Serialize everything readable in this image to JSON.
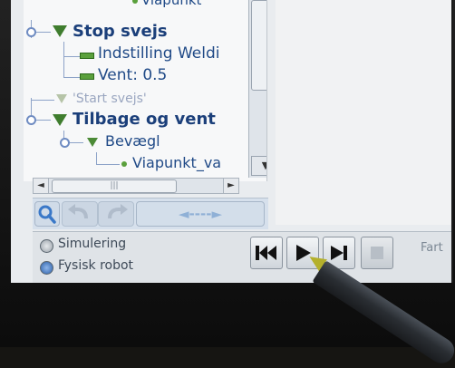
{
  "tree": {
    "top_partial": "Viapunkt",
    "items": [
      {
        "label": "Stop svejs"
      },
      {
        "label": "Indstilling Weldi"
      },
      {
        "label": "Vent: 0.5"
      },
      {
        "label": "'Start svejs'"
      },
      {
        "label": "Tilbage og vent"
      },
      {
        "label": "Bevægl"
      },
      {
        "label": "Viapunkt_va"
      }
    ]
  },
  "scrollbars": {
    "down_arrow": "▼",
    "left_arrow": "◄",
    "right_arrow": "►",
    "h_grip": "|||"
  },
  "toolbar": {
    "move_arrow": "◄----►"
  },
  "mode": {
    "simulation_label": "Simulering",
    "real_robot_label": "Fysisk robot",
    "selected": "Fysisk robot"
  },
  "playback": {
    "speed_label": "Fart"
  },
  "colors": {
    "tree_text": "#204a87",
    "node_green": "#3f7d2e",
    "toolbar_bg": "#d6e0ec"
  }
}
